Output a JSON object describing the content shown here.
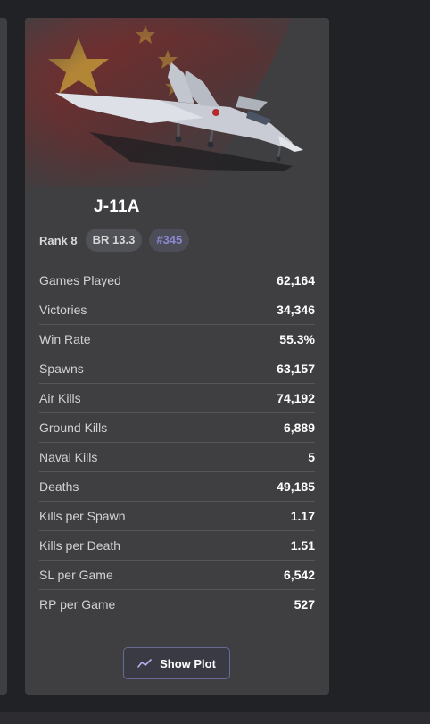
{
  "vehicle": {
    "name": "J-11A",
    "rank": "Rank 8",
    "br": "BR 13.3",
    "position": "#345",
    "image_icon": "jet-fighter-image"
  },
  "stats": [
    {
      "label": "Games Played",
      "value": "62,164"
    },
    {
      "label": "Victories",
      "value": "34,346"
    },
    {
      "label": "Win Rate",
      "value": "55.3%"
    },
    {
      "label": "Spawns",
      "value": "63,157"
    },
    {
      "label": "Air Kills",
      "value": "74,192"
    },
    {
      "label": "Ground Kills",
      "value": "6,889"
    },
    {
      "label": "Naval Kills",
      "value": "5"
    },
    {
      "label": "Deaths",
      "value": "49,185"
    },
    {
      "label": "Kills per Spawn",
      "value": "1.17"
    },
    {
      "label": "Kills per Death",
      "value": "1.51"
    },
    {
      "label": "SL per Game",
      "value": "6,542"
    },
    {
      "label": "RP per Game",
      "value": "527"
    }
  ],
  "actions": {
    "show_plot_label": "Show Plot",
    "show_plot_icon": "trend-line-icon"
  },
  "colors": {
    "background": "#212226",
    "card": "#3f3f42",
    "accent": "#8e88d6",
    "flag_red": "#8a2a2a",
    "flag_star": "#d4b030"
  }
}
